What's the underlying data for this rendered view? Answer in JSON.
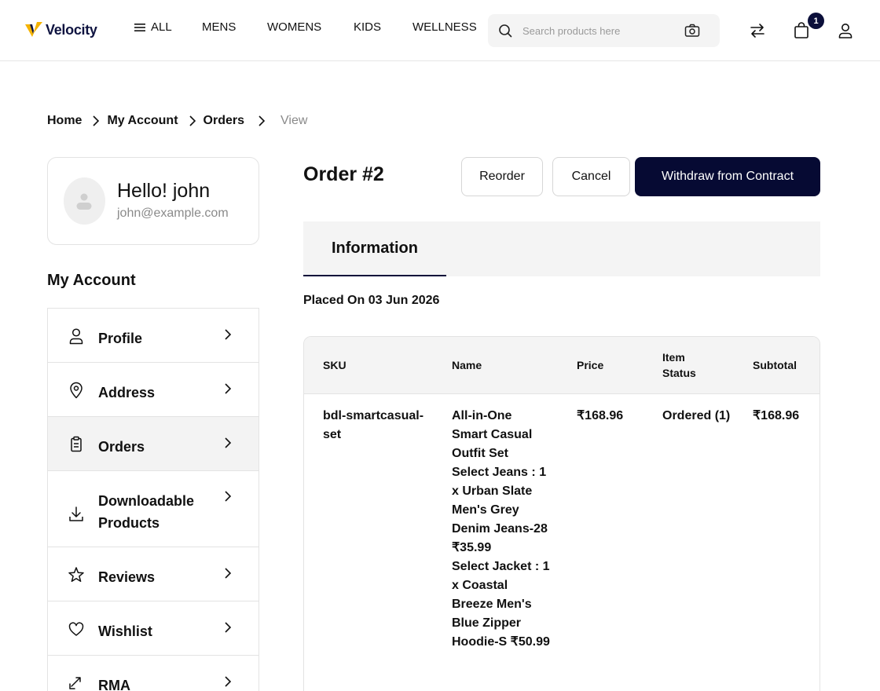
{
  "brand": {
    "name": "Velocity",
    "accent": "#f5b301",
    "primary": "#060a33"
  },
  "nav": {
    "all": "ALL",
    "mens": "MENS",
    "womens": "WOMENS",
    "kids": "KIDS",
    "wellness": "WELLNESS"
  },
  "search": {
    "placeholder": "Search products here",
    "value": ""
  },
  "cart": {
    "count": "1"
  },
  "breadcrumb": [
    "Home",
    "My Account",
    "Orders",
    "View"
  ],
  "profile": {
    "greeting": "Hello! john",
    "email": "john@example.com"
  },
  "sidebar": {
    "title": "My Account",
    "items": [
      {
        "label": "Profile",
        "icon": "user-icon"
      },
      {
        "label": "Address",
        "icon": "location-pin-icon"
      },
      {
        "label": "Orders",
        "icon": "clipboard-icon",
        "active": true
      },
      {
        "label_line1": "Downloadable",
        "label_line2": "Products",
        "icon": "download-icon"
      },
      {
        "label": "Reviews",
        "icon": "star-icon"
      },
      {
        "label": "Wishlist",
        "icon": "heart-icon"
      },
      {
        "label": "RMA",
        "icon": "exchange-icon"
      }
    ]
  },
  "order": {
    "title": "Order #2",
    "buttons": {
      "reorder": "Reorder",
      "cancel": "Cancel",
      "withdraw": "Withdraw from Contract"
    },
    "tab": "Information",
    "placed_on": "Placed On 03 Jun 2026",
    "table": {
      "headers": {
        "sku": "SKU",
        "name": "Name",
        "price": "Price",
        "status": "Item Status",
        "subtotal": "Subtotal"
      },
      "rows": [
        {
          "sku": "bdl-smartcasual-set",
          "name": "All-in-One Smart Casual Outfit Set",
          "option1_label": "Select Jeans :",
          "option1_value": "1 x Urban Slate Men's Grey Denim Jeans-28 ₹35.99",
          "option2_label": "Select Jacket :",
          "option2_value": "1 x Coastal Breeze Men's Blue Zipper Hoodie-S ₹50.99",
          "price": "₹168.96",
          "status": "Ordered (1)",
          "subtotal": "₹168.96"
        }
      ]
    }
  }
}
